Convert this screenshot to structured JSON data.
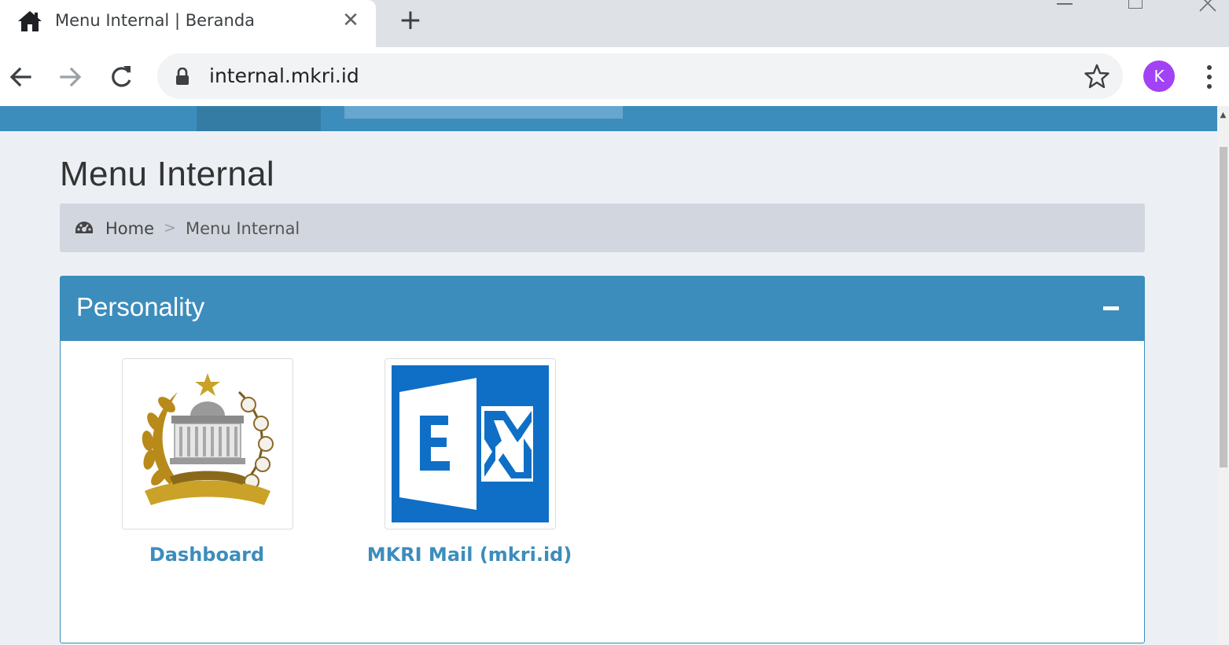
{
  "browser": {
    "tab_title": "Menu Internal | Beranda",
    "tab_icon": "home-icon",
    "url": "internal.mkri.id",
    "profile_initial": "K",
    "colors": {
      "profile": "#a142f4",
      "chrome_bg": "#dee1e6"
    }
  },
  "page": {
    "title": "Menu Internal",
    "breadcrumb": {
      "home": "Home",
      "separator": ">",
      "current": "Menu Internal"
    },
    "box": {
      "title": "Personality",
      "collapse_icon": "minus-icon",
      "apps": [
        {
          "label": "Dashboard",
          "icon": "mkri-emblem-logo"
        },
        {
          "label": "MKRI Mail (mkri.id)",
          "icon": "exchange-logo"
        }
      ]
    },
    "colors": {
      "primary": "#3c8dbc",
      "body_bg": "#ecf0f5",
      "breadcrumb_bg": "#d2d6de"
    }
  }
}
